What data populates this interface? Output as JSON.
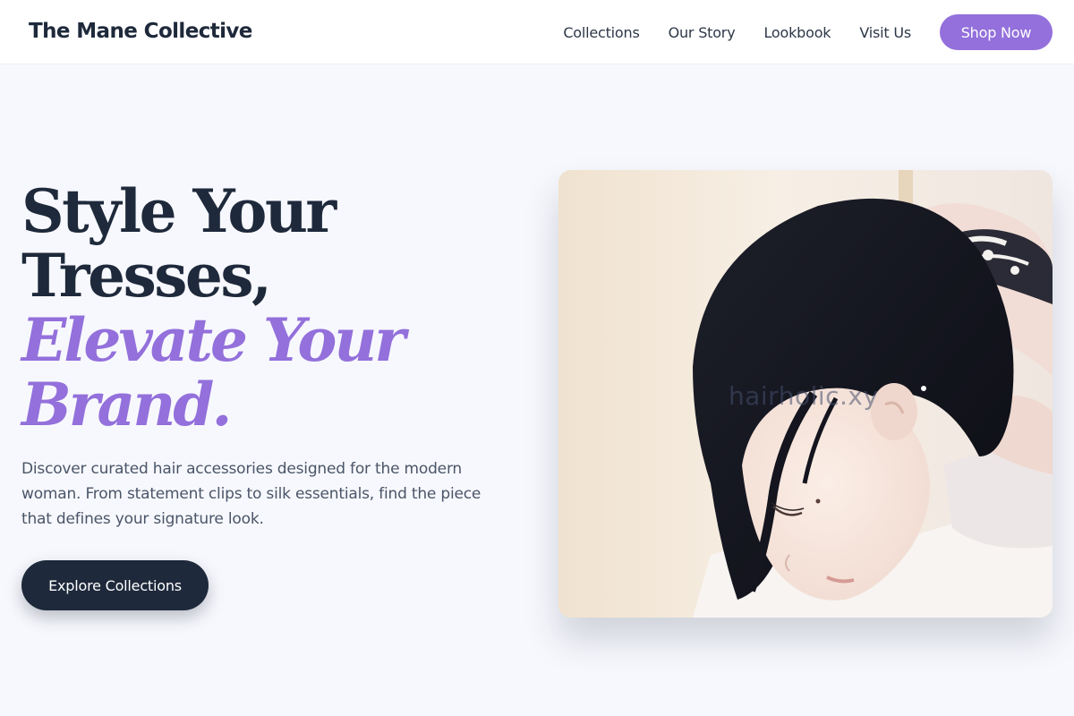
{
  "header": {
    "brand": "The Mane Collective",
    "nav": [
      {
        "label": "Collections"
      },
      {
        "label": "Our Story"
      },
      {
        "label": "Lookbook"
      },
      {
        "label": "Visit Us"
      }
    ],
    "cta_label": "Shop Now"
  },
  "hero": {
    "title_lines": [
      "Style Your",
      "Tresses,"
    ],
    "accent_lines": [
      "Elevate Your",
      "Brand."
    ],
    "description": "Discover curated hair accessories designed for the modern woman. From statement clips to silk essentials, find the piece that defines your signature look.",
    "cta_label": "Explore Collections",
    "image": {
      "watermark": "hairholic.xy",
      "subject": "woman tying up dark hair with patterned scarf"
    }
  },
  "colors": {
    "accent": "#9370db",
    "dark": "#1e293b",
    "background": "#f7f8fd",
    "body_text": "#4a5568"
  }
}
